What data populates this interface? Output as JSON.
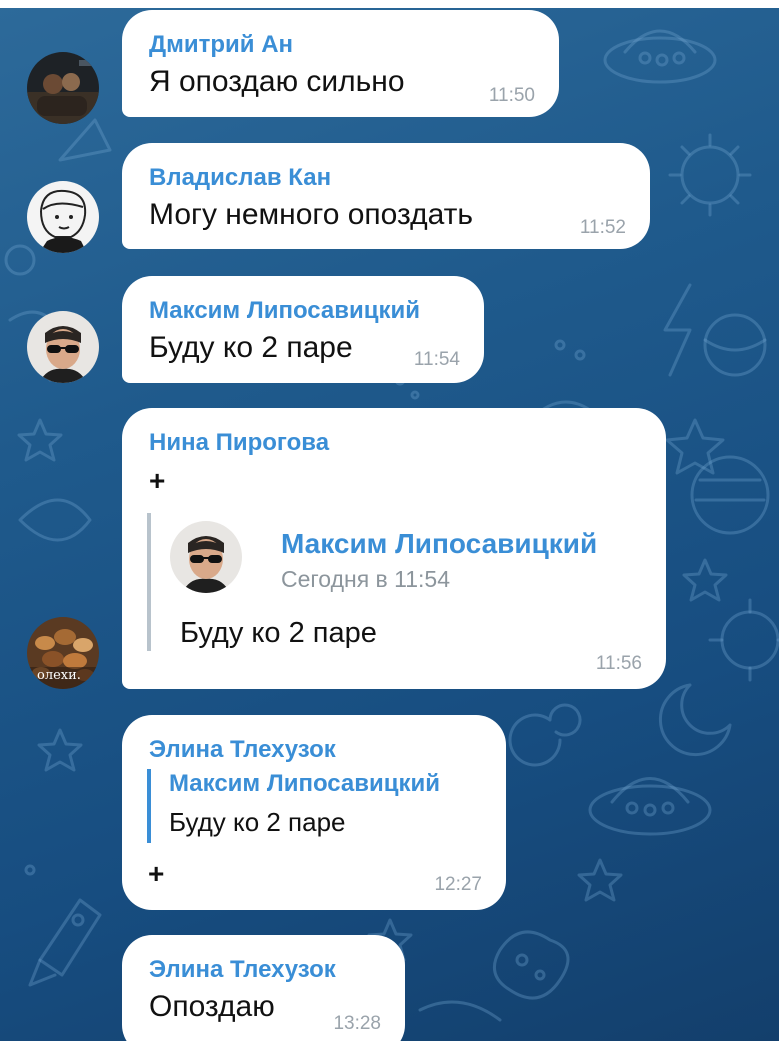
{
  "messages": [
    {
      "sender": "Дмитрий Ан",
      "text": "Я опоздаю сильно",
      "time": "11:50",
      "avatar": "dark-photo"
    },
    {
      "sender": "Владислав Кан",
      "text": "Могу немного опоздать",
      "time": "11:52",
      "avatar": "sketch-portrait"
    },
    {
      "sender": "Максим Липосавицкий",
      "text": "Буду ко 2 паре",
      "time": "11:54",
      "avatar": "sunglasses-photo"
    },
    {
      "sender": "Нина Пирогова",
      "text": "+",
      "time": "11:56",
      "avatar": "nuts-photo",
      "avatar_caption": "олехи.",
      "forwarded": {
        "sender": "Максим Липосавицкий",
        "date": "Сегодня в 11:54",
        "text": "Буду ко 2 паре",
        "avatar": "sunglasses-photo"
      }
    },
    {
      "sender": "Элина Тлехузок",
      "text": "+",
      "time": "12:27",
      "reply": {
        "sender": "Максим Липосавицкий",
        "text": "Буду ко 2 паре"
      }
    },
    {
      "sender": "Элина Тлехузок",
      "text": "Опоздаю",
      "time": "13:28"
    }
  ],
  "colors": {
    "background": "#1f5a8c",
    "bubble": "#ffffff",
    "sender_name": "#3a8ed6",
    "timestamp": "#9aa3ab"
  }
}
